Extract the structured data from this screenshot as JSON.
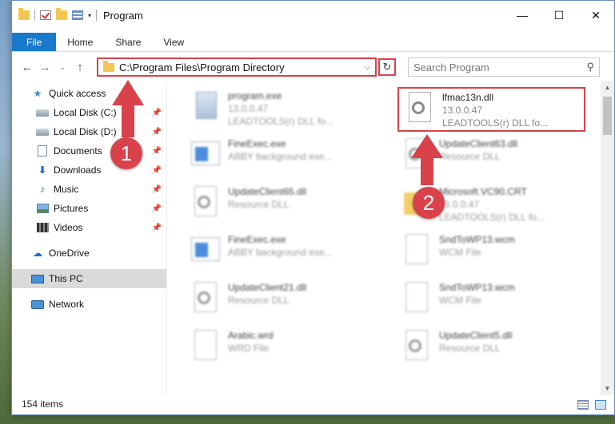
{
  "window": {
    "title": "Program"
  },
  "ribbon": {
    "tabs": [
      "File",
      "Home",
      "Share",
      "View"
    ]
  },
  "address": {
    "path": "C:\\Program Files\\Program Directory"
  },
  "search": {
    "placeholder": "Search Program"
  },
  "sidebar": {
    "quick_access": "Quick access",
    "items": [
      {
        "label": "Local Disk (C:)",
        "icon": "disk-icon"
      },
      {
        "label": "Local Disk (D:)",
        "icon": "disk-icon"
      },
      {
        "label": "Documents",
        "icon": "document-icon"
      },
      {
        "label": "Downloads",
        "icon": "download-icon"
      },
      {
        "label": "Music",
        "icon": "music-icon"
      },
      {
        "label": "Pictures",
        "icon": "pictures-icon"
      },
      {
        "label": "Videos",
        "icon": "videos-icon"
      }
    ],
    "onedrive": "OneDrive",
    "this_pc": "This PC",
    "network": "Network"
  },
  "files": [
    {
      "name": "program.exe",
      "sub1": "13.0.0.47",
      "sub2": "LEADTOOLS(r) DLL fo..."
    },
    {
      "name": "lfmac13n.dll",
      "sub1": "13.0.0.47",
      "sub2": "LEADTOOLS(r) DLL fo..."
    },
    {
      "name": "FineExec.exe",
      "sub1": "ABBY background exe..."
    },
    {
      "name": "UpdateClient63.dll",
      "sub1": "Resource DLL"
    },
    {
      "name": "UpdateClient65.dll",
      "sub1": "Resource DLL"
    },
    {
      "name": "Microsoft.VC90.CRT",
      "sub1": "13.0.0.47",
      "sub2": "LEADTOOLS(r) DLL fo..."
    },
    {
      "name": "FineExec.exe",
      "sub1": "ABBY background exe..."
    },
    {
      "name": "SndToWP13.wcm",
      "sub1": "WCM File"
    },
    {
      "name": "UpdateClient21.dll",
      "sub1": "Resource DLL"
    },
    {
      "name": "SndToWP13.wcm",
      "sub1": "WCM File"
    },
    {
      "name": "Arabic.wrd",
      "sub1": "WRD File"
    },
    {
      "name": "UpdateClient5.dll",
      "sub1": "Resource DLL"
    }
  ],
  "status": {
    "item_count": "154 items"
  },
  "annotations": {
    "step1": "1",
    "step2": "2",
    "color": "#d9424b"
  }
}
